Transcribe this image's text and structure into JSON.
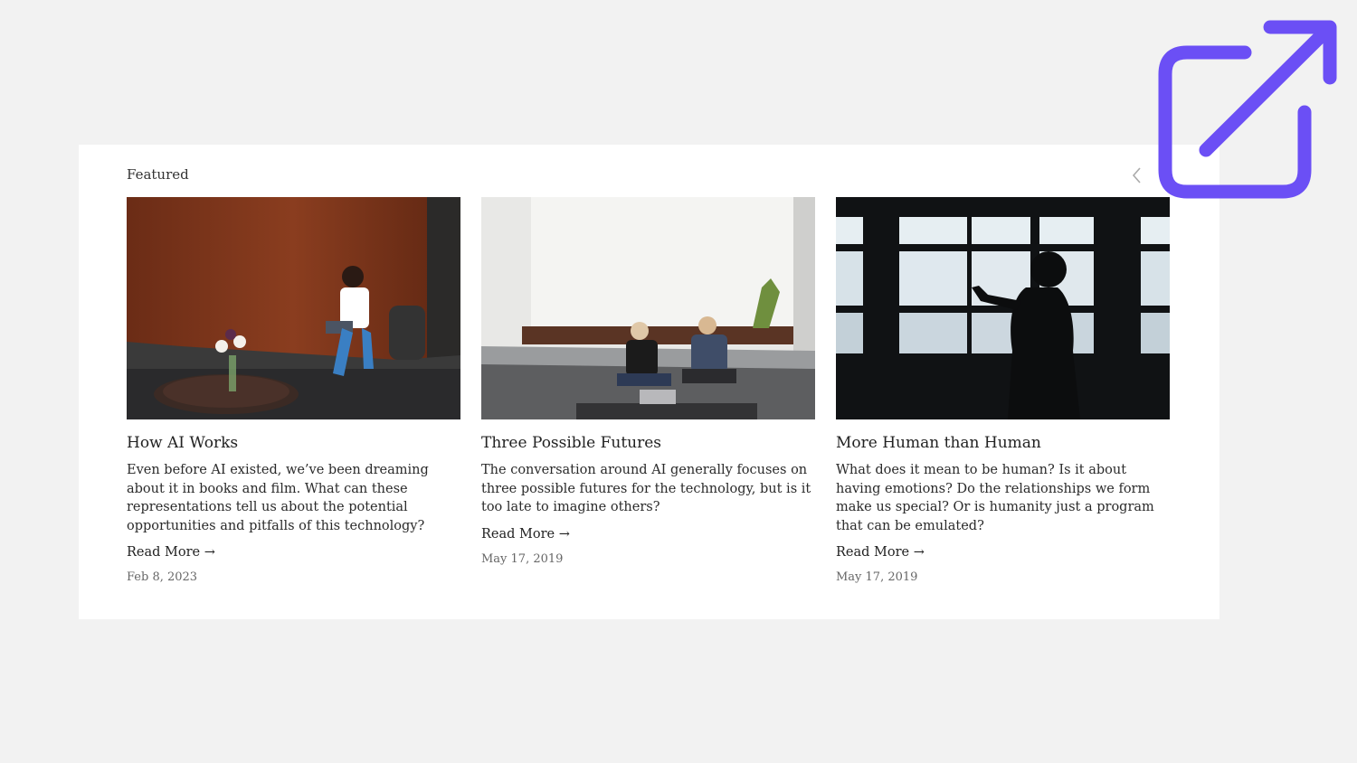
{
  "section": {
    "label": "Featured"
  },
  "carousel": {
    "prev_icon": "chevron-left-icon",
    "next_icon": "chevron-right-icon"
  },
  "cards": [
    {
      "title": "How AI Works",
      "excerpt": "Even before AI existed, we’ve been dreaming about it in books and film. What can these representations tell us about the potential opportunities and pitfalls of this technology?",
      "read_more": "Read More →",
      "date": "Feb 8, 2023"
    },
    {
      "title": "Three Possible Futures",
      "excerpt": "The conversation around AI generally focuses on three possible futures for the technology, but is it too late to imagine others?",
      "read_more": "Read More →",
      "date": "May 17, 2019"
    },
    {
      "title": "More Human than Human",
      "excerpt": "What does it mean to be human? Is it about having emotions? Do the relationships we form make us special? Or is humanity just a program that can be emulated?",
      "read_more": "Read More →",
      "date": "May 17, 2019"
    }
  ],
  "overlay": {
    "icon": "external-link-icon",
    "color": "#6b4ff5"
  }
}
